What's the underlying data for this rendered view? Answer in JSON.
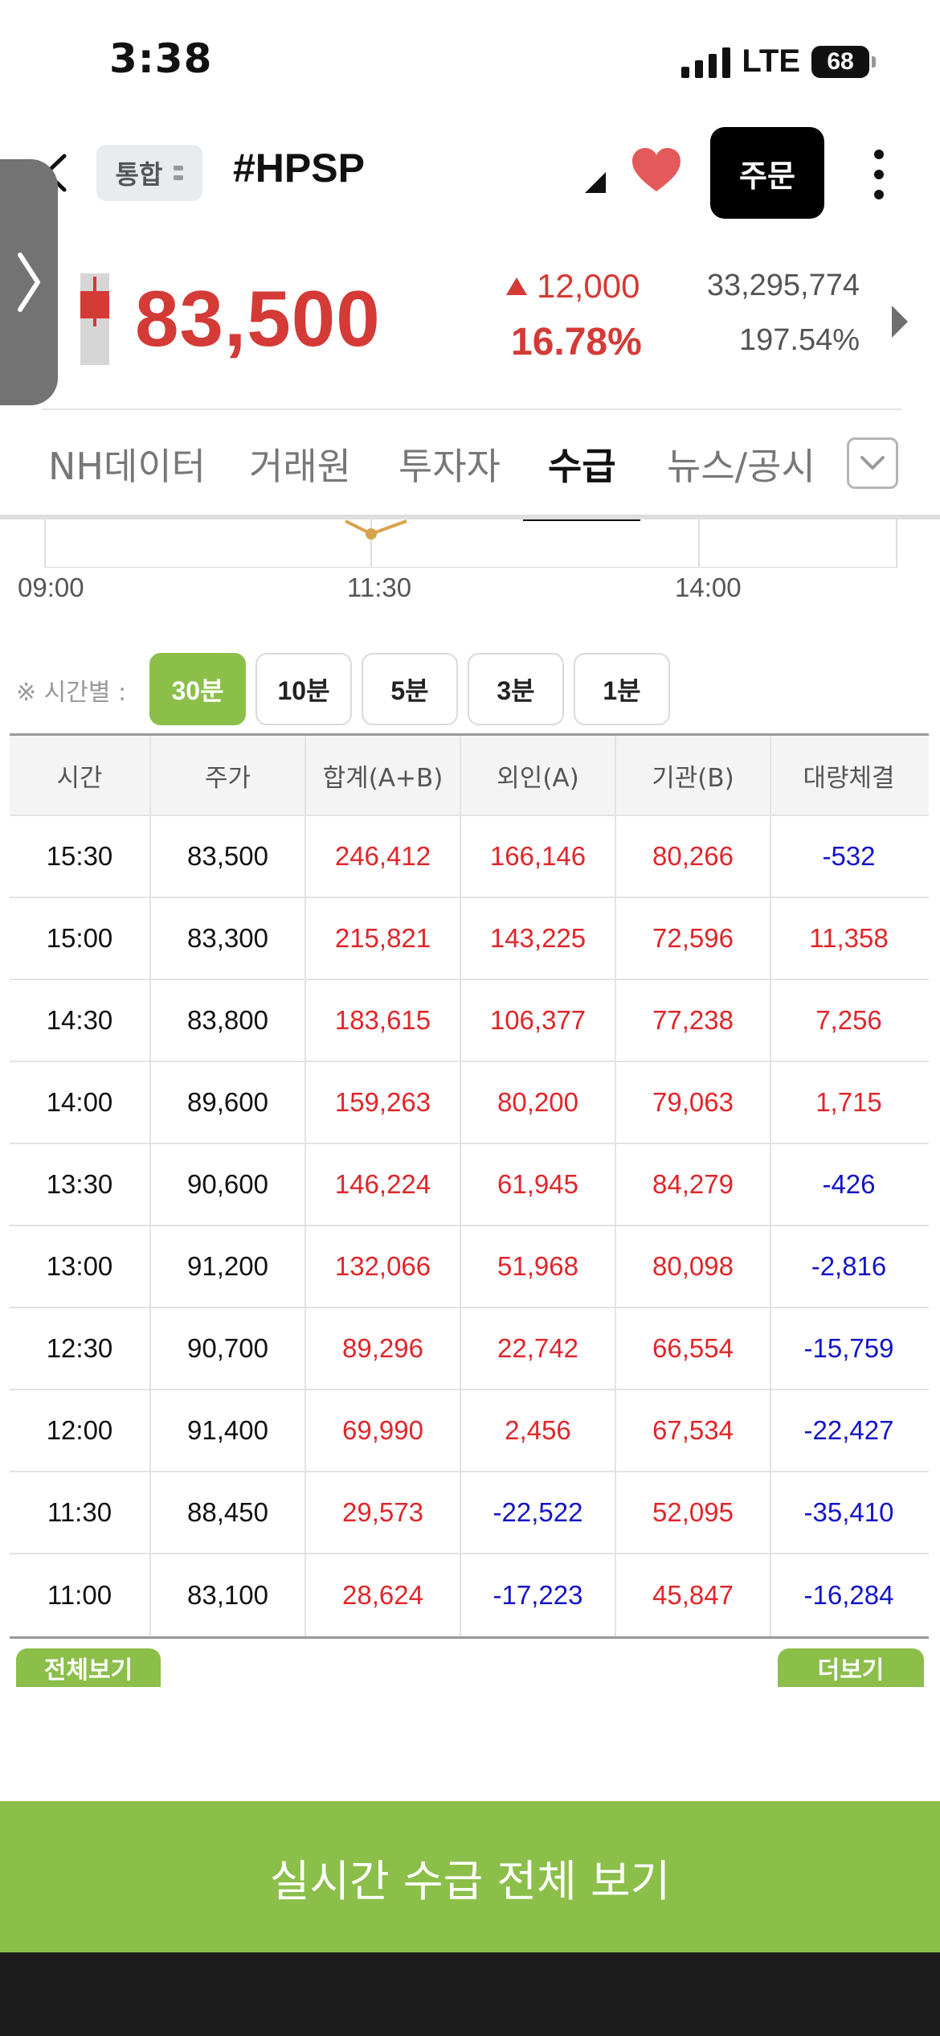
{
  "status_bar": {
    "time": "3:38",
    "network": "LTE",
    "battery": "68"
  },
  "header": {
    "badge": "통합",
    "stock_name": "#HPSP",
    "order_button": "주문"
  },
  "quote": {
    "price": "83,500",
    "change": "12,000",
    "change_pct": "16.78%",
    "volume": "33,295,774",
    "turnover_ratio": "197.54%",
    "color_up": "#d43a36"
  },
  "tabs": {
    "items": [
      {
        "label": "NH데이터"
      },
      {
        "label": "거래원"
      },
      {
        "label": "투자자"
      },
      {
        "label": "수급"
      },
      {
        "label": "뉴스/공시"
      }
    ],
    "active_index": 3
  },
  "chart": {
    "time_labels": [
      "09:00",
      "11:30",
      "14:00"
    ]
  },
  "interval": {
    "label": "※ 시간별 :",
    "options": [
      "30분",
      "10분",
      "5분",
      "3분",
      "1분"
    ],
    "active_index": 0,
    "accent": "#8bbf4a"
  },
  "table": {
    "headers": [
      "시간",
      "주가",
      "합계(A+B)",
      "외인(A)",
      "기관(B)",
      "대량체결"
    ],
    "rows": [
      [
        "15:30",
        "83,500",
        "246,412",
        "166,146",
        "80,266",
        "-532"
      ],
      [
        "15:00",
        "83,300",
        "215,821",
        "143,225",
        "72,596",
        "11,358"
      ],
      [
        "14:30",
        "83,800",
        "183,615",
        "106,377",
        "77,238",
        "7,256"
      ],
      [
        "14:00",
        "89,600",
        "159,263",
        "80,200",
        "79,063",
        "1,715"
      ],
      [
        "13:30",
        "90,600",
        "146,224",
        "61,945",
        "84,279",
        "-426"
      ],
      [
        "13:00",
        "91,200",
        "132,066",
        "51,968",
        "80,098",
        "-2,816"
      ],
      [
        "12:30",
        "90,700",
        "89,296",
        "22,742",
        "66,554",
        "-15,759"
      ],
      [
        "12:00",
        "91,400",
        "69,990",
        "2,456",
        "67,534",
        "-22,427"
      ],
      [
        "11:30",
        "88,450",
        "29,573",
        "-22,522",
        "52,095",
        "-35,410"
      ],
      [
        "11:00",
        "83,100",
        "28,624",
        "-17,223",
        "45,847",
        "-16,284"
      ]
    ]
  },
  "view_all_label": "전체보기",
  "more_label": "더보기",
  "realtime_button": "실시간 수급 전체 보기"
}
